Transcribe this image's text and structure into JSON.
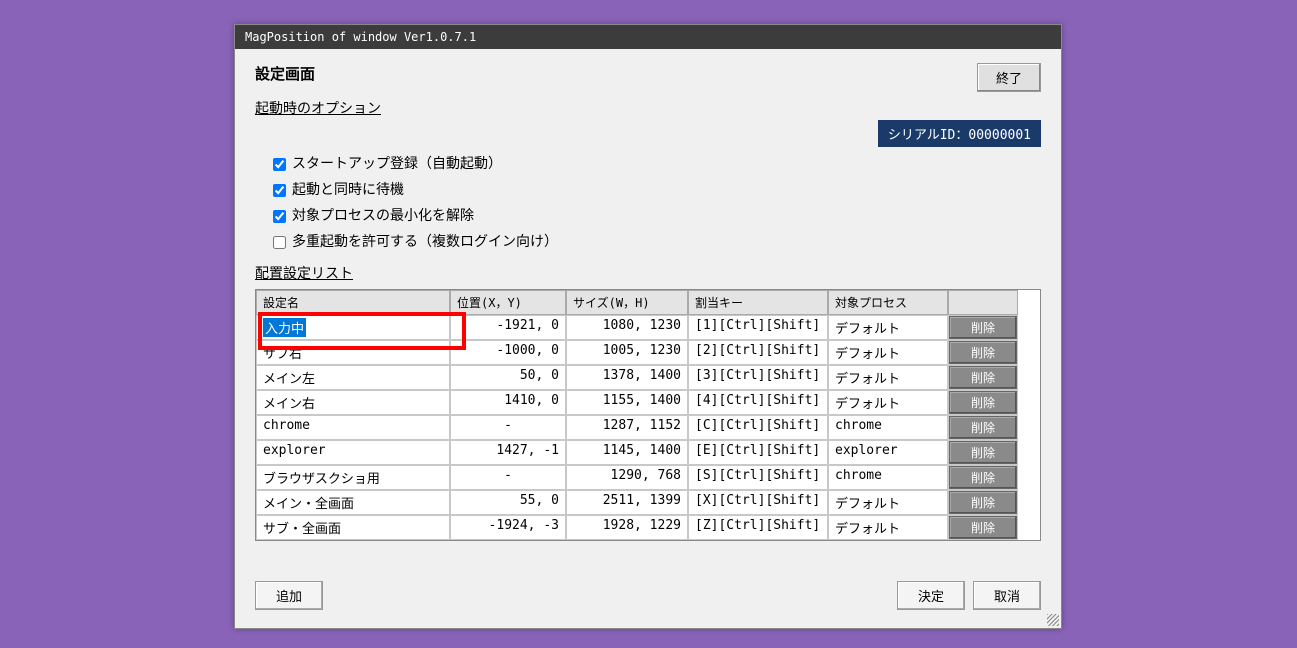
{
  "window_title": "MagPosition of window Ver1.0.7.1",
  "page_title": "設定画面",
  "exit_label": "終了",
  "section_startup": "起動時のオプション",
  "serial_label": "シリアルID：00000001",
  "checkboxes": [
    {
      "label": "スタートアップ登録（自動起動）",
      "checked": true
    },
    {
      "label": "起動と同時に待機",
      "checked": true
    },
    {
      "label": "対象プロセスの最小化を解除",
      "checked": true
    },
    {
      "label": "多重起動を許可する（複数ログイン向け）",
      "checked": false
    }
  ],
  "list_title": "配置設定リスト",
  "columns": {
    "name": "設定名",
    "pos": "位置(X，Y)",
    "size": "サイズ(W，H)",
    "key": "割当キー",
    "proc": "対象プロセス"
  },
  "delete_label": "削除",
  "editing_value": "入力中",
  "rows": [
    {
      "name": "",
      "pos": "-1921,    0",
      "size": "1080, 1230",
      "key": "[1][Ctrl][Shift]",
      "proc": "デフォルト",
      "editing": true
    },
    {
      "name": "サブ右",
      "pos": "-1000,    0",
      "size": "1005, 1230",
      "key": "[2][Ctrl][Shift]",
      "proc": "デフォルト"
    },
    {
      "name": "メイン左",
      "pos": "50,    0",
      "size": "1378, 1400",
      "key": "[3][Ctrl][Shift]",
      "proc": "デフォルト"
    },
    {
      "name": "メイン右",
      "pos": "1410,    0",
      "size": "1155, 1400",
      "key": "[4][Ctrl][Shift]",
      "proc": "デフォルト"
    },
    {
      "name": "chrome",
      "pos": "-",
      "size": "1287, 1152",
      "key": "[C][Ctrl][Shift]",
      "proc": "chrome",
      "center": true
    },
    {
      "name": "explorer",
      "pos": "1427,   -1",
      "size": "1145, 1400",
      "key": "[E][Ctrl][Shift]",
      "proc": "explorer"
    },
    {
      "name": "ブラウザスクショ用",
      "pos": "-",
      "size": "1290,  768",
      "key": "[S][Ctrl][Shift]",
      "proc": "chrome",
      "center": true
    },
    {
      "name": "メイン・全画面",
      "pos": "55,    0",
      "size": "2511, 1399",
      "key": "[X][Ctrl][Shift]",
      "proc": "デフォルト"
    },
    {
      "name": "サブ・全画面",
      "pos": "-1924,   -3",
      "size": "1928, 1229",
      "key": "[Z][Ctrl][Shift]",
      "proc": "デフォルト"
    }
  ],
  "footer": {
    "add": "追加",
    "ok": "決定",
    "cancel": "取消"
  }
}
